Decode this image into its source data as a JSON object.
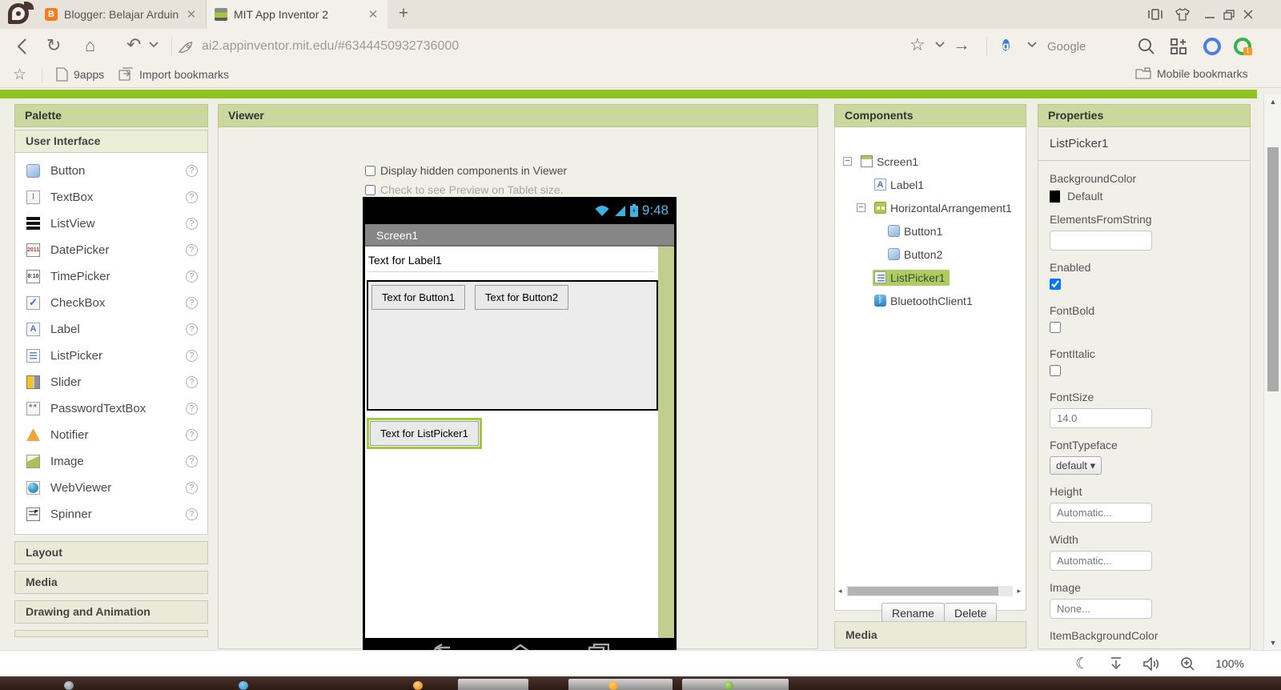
{
  "browser": {
    "tab1": {
      "title": "Blogger: Belajar Arduino -"
    },
    "tab2": {
      "title": "MIT App Inventor 2"
    },
    "new_tab": "+",
    "url": "ai2.appinventor.mit.edu/#6344450932736000",
    "search_label": "Google",
    "bookmarks_bar": {
      "apps": "9apps",
      "import": "Import bookmarks",
      "mobile": "Mobile bookmarks"
    },
    "status_bar": {
      "zoom_level": "100%"
    }
  },
  "app": {
    "palette": {
      "title": "Palette",
      "active_section": "User Interface",
      "items": [
        {
          "label": "Button",
          "icon": "button"
        },
        {
          "label": "TextBox",
          "icon": "textbox"
        },
        {
          "label": "ListView",
          "icon": "listview"
        },
        {
          "label": "DatePicker",
          "icon": "datepicker"
        },
        {
          "label": "TimePicker",
          "icon": "timepicker"
        },
        {
          "label": "CheckBox",
          "icon": "checkbox"
        },
        {
          "label": "Label",
          "icon": "label"
        },
        {
          "label": "ListPicker",
          "icon": "listpicker"
        },
        {
          "label": "Slider",
          "icon": "slider"
        },
        {
          "label": "PasswordTextBox",
          "icon": "password"
        },
        {
          "label": "Notifier",
          "icon": "notifier"
        },
        {
          "label": "Image",
          "icon": "image"
        },
        {
          "label": "WebViewer",
          "icon": "webviewer"
        },
        {
          "label": "Spinner",
          "icon": "spinner"
        }
      ],
      "collapsed_sections": [
        "Layout",
        "Media",
        "Drawing and Animation"
      ]
    },
    "viewer": {
      "title": "Viewer",
      "option1": "Display hidden components in Viewer",
      "option2": "Check to see Preview on Tablet size.",
      "phone": {
        "status_time": "9:48",
        "screen_title": "Screen1",
        "label1_text": "Text for Label1",
        "button1_text": "Text for Button1",
        "button2_text": "Text for Button2",
        "listpicker_text": "Text for ListPicker1"
      }
    },
    "components": {
      "title": "Components",
      "tree": [
        {
          "label": "Screen1",
          "depth": 0,
          "expander": true,
          "icon": "screen",
          "selected": false
        },
        {
          "label": "Label1",
          "depth": 1,
          "expander": false,
          "icon": "label",
          "selected": false
        },
        {
          "label": "HorizontalArrangement1",
          "depth": 1,
          "expander": true,
          "icon": "harrangement",
          "selected": false
        },
        {
          "label": "Button1",
          "depth": 2,
          "expander": false,
          "icon": "button",
          "selected": false
        },
        {
          "label": "Button2",
          "depth": 2,
          "expander": false,
          "icon": "button",
          "selected": false
        },
        {
          "label": "ListPicker1",
          "depth": 1,
          "expander": false,
          "icon": "listpicker",
          "selected": true
        },
        {
          "label": "BluetoothClient1",
          "depth": 1,
          "expander": false,
          "icon": "bluetooth",
          "selected": false
        }
      ],
      "rename_button": "Rename",
      "delete_button": "Delete",
      "next_section": "Media"
    },
    "properties": {
      "title": "Properties",
      "component_name": "ListPicker1",
      "fields": [
        {
          "name": "BackgroundColor",
          "type": "color",
          "value": "Default",
          "swatch": "#000000"
        },
        {
          "name": "ElementsFromString",
          "type": "textinput",
          "value": ""
        },
        {
          "name": "Enabled",
          "type": "checkbox",
          "checked": true
        },
        {
          "name": "FontBold",
          "type": "checkbox",
          "checked": false
        },
        {
          "name": "FontItalic",
          "type": "checkbox",
          "checked": false
        },
        {
          "name": "FontSize",
          "type": "textinput",
          "value": "14.0"
        },
        {
          "name": "FontTypeface",
          "type": "dropdown",
          "value": "default"
        },
        {
          "name": "Height",
          "type": "textinput",
          "value": "Automatic..."
        },
        {
          "name": "Width",
          "type": "textinput",
          "value": "Automatic..."
        },
        {
          "name": "Image",
          "type": "textinput",
          "value": "None..."
        },
        {
          "name": "ItemBackgroundColor",
          "type": "labelonly",
          "value": ""
        }
      ]
    }
  }
}
